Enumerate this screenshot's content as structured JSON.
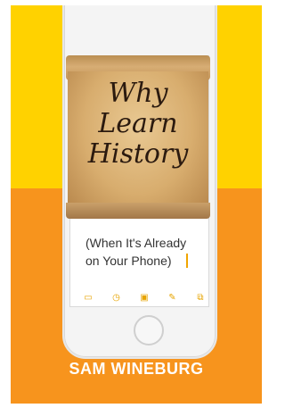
{
  "cover": {
    "top_dots": "• • • • • • • • •",
    "title_lines": [
      "Why",
      "Learn",
      "History"
    ],
    "subtitle": "(When It's Already\non Your Phone)",
    "author": "SAM WINEBURG",
    "colors": {
      "yellow": "#ffd200",
      "orange": "#f7941d",
      "text_dark": "#2b1a0f"
    },
    "icons": [
      "clipboard-icon",
      "clock-icon",
      "camera-icon",
      "pen-icon",
      "edit-icon"
    ]
  }
}
